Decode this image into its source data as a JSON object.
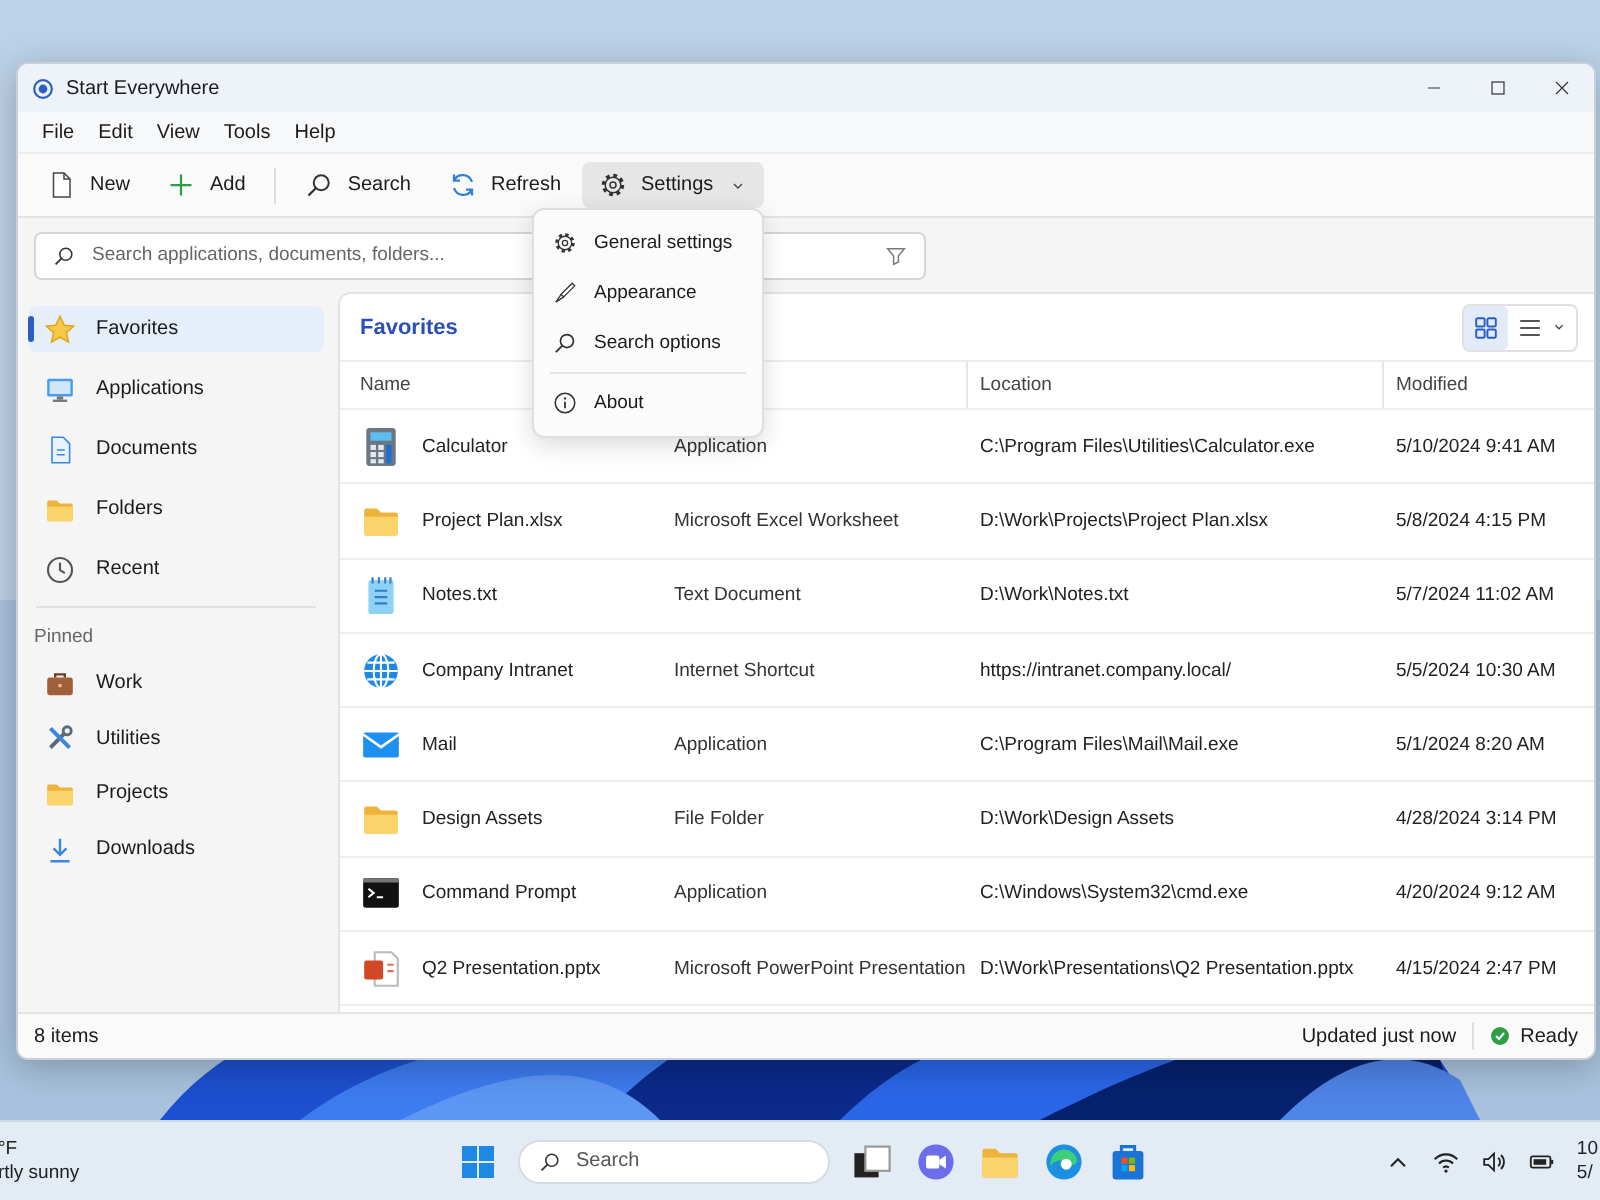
{
  "window": {
    "title": "Start Everywhere"
  },
  "menu_bar": [
    "File",
    "Edit",
    "View",
    "Tools",
    "Help"
  ],
  "toolbar": [
    {
      "kind": "new",
      "label": "New"
    },
    {
      "kind": "add",
      "label": "Add"
    },
    {
      "kind": "separator"
    },
    {
      "kind": "search",
      "label": "Search"
    },
    {
      "kind": "refresh",
      "label": "Refresh"
    },
    {
      "kind": "settings",
      "label": "Settings",
      "expanded": true
    }
  ],
  "settings_menu": [
    {
      "kind": "gear",
      "label": "General settings"
    },
    {
      "kind": "brush",
      "label": "Appearance"
    },
    {
      "kind": "search",
      "label": "Search options"
    },
    {
      "kind": "separator"
    },
    {
      "kind": "info",
      "label": "About"
    }
  ],
  "search": {
    "placeholder": "Search applications, documents, folders..."
  },
  "sidebar": {
    "items": [
      {
        "kind": "star",
        "label": "Favorites",
        "selected": true
      },
      {
        "kind": "monitor",
        "label": "Applications",
        "selected": false
      },
      {
        "kind": "document",
        "label": "Documents",
        "selected": false
      },
      {
        "kind": "folder",
        "label": "Folders",
        "selected": false
      },
      {
        "kind": "clock",
        "label": "Recent",
        "selected": false
      }
    ],
    "section_title": "Pinned",
    "pinned": [
      {
        "kind": "briefcase",
        "label": "Work",
        "selected": false
      },
      {
        "kind": "tools",
        "label": "Utilities",
        "selected": false
      },
      {
        "kind": "folder",
        "label": "Projects",
        "selected": false
      },
      {
        "kind": "download",
        "label": "Downloads",
        "selected": false
      }
    ]
  },
  "content": {
    "title": "Favorites",
    "view_modes": [
      {
        "kind": "grid",
        "selected": true
      },
      {
        "kind": "list",
        "selected": false
      }
    ],
    "columns": [
      "Name",
      "Location",
      "Modified"
    ],
    "rows": [
      {
        "kind": "calculator",
        "name": "Calculator",
        "type": "Application",
        "location": "C:\\Program Files\\Utilities\\Calculator.exe",
        "modified": "5/10/2024 9:41 AM"
      },
      {
        "kind": "folder",
        "name": "Project Plan.xlsx",
        "type": "Microsoft Excel Worksheet",
        "location": "D:\\Work\\Projects\\Project Plan.xlsx",
        "modified": "5/8/2024 4:15 PM"
      },
      {
        "kind": "notes",
        "name": "Notes.txt",
        "type": "Text Document",
        "location": "D:\\Work\\Notes.txt",
        "modified": "5/7/2024 11:02 AM"
      },
      {
        "kind": "globe",
        "name": "Company Intranet",
        "type": "Internet Shortcut",
        "location": "https://intranet.company.local/",
        "modified": "5/5/2024 10:30 AM"
      },
      {
        "kind": "mail",
        "name": "Mail",
        "type": "Application",
        "location": "C:\\Program Files\\Mail\\Mail.exe",
        "modified": "5/1/2024 8:20 AM"
      },
      {
        "kind": "folder",
        "name": "Design Assets",
        "type": "File Folder",
        "location": "D:\\Work\\Design Assets",
        "modified": "4/28/2024 3:14 PM"
      },
      {
        "kind": "terminal",
        "name": "Command Prompt",
        "type": "Application",
        "location": "C:\\Windows\\System32\\cmd.exe",
        "modified": "4/20/2024 9:12 AM"
      },
      {
        "kind": "slides",
        "name": "Q2 Presentation.pptx",
        "type": "Microsoft PowerPoint Presentation",
        "location": "D:\\Work\\Presentations\\Q2 Presentation.pptx",
        "modified": "4/15/2024 2:47 PM"
      }
    ]
  },
  "status_bar": {
    "count": "8 items",
    "updated": "Updated just now",
    "state": "Ready"
  },
  "taskbar": {
    "weather_temp": "°F",
    "weather_text": "rtly sunny",
    "search_placeholder": "Search",
    "time": "10",
    "date": "5/"
  }
}
